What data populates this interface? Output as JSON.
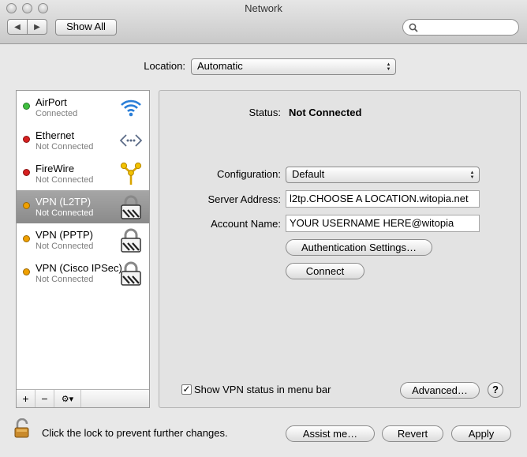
{
  "window": {
    "title": "Network"
  },
  "toolbar": {
    "show_all_label": "Show All",
    "search_placeholder": ""
  },
  "location": {
    "label": "Location:",
    "value": "Automatic"
  },
  "services": [
    {
      "name": "AirPort",
      "status": "Connected",
      "dot_color": "#3fbf3f",
      "icon": "wifi-icon"
    },
    {
      "name": "Ethernet",
      "status": "Not Connected",
      "dot_color": "#d62020",
      "icon": "ethernet-icon"
    },
    {
      "name": "FireWire",
      "status": "Not Connected",
      "dot_color": "#d62020",
      "icon": "firewire-icon"
    },
    {
      "name": "VPN (L2TP)",
      "status": "Not Connected",
      "dot_color": "#f0a000",
      "icon": "vpn-lock-icon",
      "selected": true
    },
    {
      "name": "VPN (PPTP)",
      "status": "Not Connected",
      "dot_color": "#f0a000",
      "icon": "vpn-lock-icon"
    },
    {
      "name": "VPN (Cisco IPSec)",
      "status": "Not Connected",
      "dot_color": "#f0a000",
      "icon": "vpn-lock-icon"
    }
  ],
  "sidebar_controls": {
    "add": "+",
    "remove": "−",
    "action": "⚙▾"
  },
  "detail": {
    "status_label": "Status:",
    "status_value": "Not Connected",
    "configuration_label": "Configuration:",
    "configuration_value": "Default",
    "server_address_label": "Server Address:",
    "server_address_value": "l2tp.CHOOSE A LOCATION.witopia.net",
    "account_name_label": "Account Name:",
    "account_name_value": "YOUR USERNAME HERE@witopia",
    "auth_button": "Authentication Settings…",
    "connect_button": "Connect",
    "show_vpn_status_label": "Show VPN status in menu bar",
    "show_vpn_status_checked": true,
    "advanced_button": "Advanced…",
    "help_label": "?"
  },
  "footer": {
    "lock_text": "Click the lock to prevent further changes.",
    "assist_button": "Assist me…",
    "revert_button": "Revert",
    "apply_button": "Apply"
  }
}
